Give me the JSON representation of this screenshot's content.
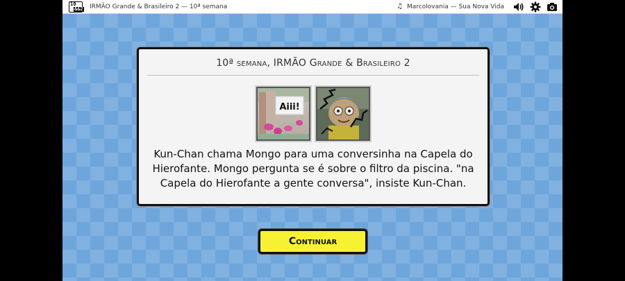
{
  "topbar": {
    "logo_top": "10",
    "logo_bottom": "&&2",
    "title": "IRMÃO Grande & Brasileiro 2 — 10ª semana",
    "song": "Marcolovania — Sua Nova Vida",
    "icons": [
      "music-note-icon",
      "volume-icon",
      "gear-icon",
      "camera-icon"
    ]
  },
  "event": {
    "title": "10ª semana, IRMÃO Grande & Brasileiro 2",
    "portraits": [
      {
        "name": "Kun-Chan",
        "caption": "Aiii!"
      },
      {
        "name": "Mongo"
      }
    ],
    "text": "Kun-Chan chama Mongo para uma conversinha na Capela do Hierofante. Mongo pergunta se é sobre o filtro da piscina. \"na Capela do Hierofante a gente conversa\", insiste Kun-Chan."
  },
  "continue_label": "Continuar",
  "colors": {
    "background": "#6ea6dc",
    "button": "#f6f233",
    "card": "#f4f4f4"
  }
}
